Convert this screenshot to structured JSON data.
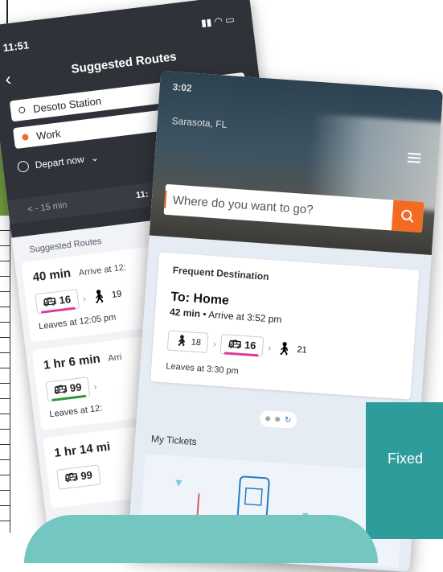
{
  "routes_screen": {
    "status_time": "11:51",
    "title": "Suggested Routes",
    "origin": "Desoto Station",
    "destination": "Work",
    "depart_label": "Depart now",
    "time_prev": "< - 15 min",
    "time_current": "11:",
    "section_label": "Suggested Routes",
    "routes": [
      {
        "duration": "40 min",
        "arrive": "Arrive at 12:",
        "bus": "16",
        "bus_color": "#e0399a",
        "walk": "19",
        "leaves": "Leaves at 12:05 pm"
      },
      {
        "duration": "1 hr 6 min",
        "arrive": "Arri",
        "bus": "99",
        "bus_color": "#2d9a3a",
        "walk": "",
        "leaves": "Leaves at 12:"
      },
      {
        "duration": "1 hr 14 mi",
        "arrive": "",
        "bus": "99",
        "bus_color": "#2d9a3a",
        "walk": "",
        "leaves": ""
      }
    ]
  },
  "home_screen": {
    "status_time": "3:02",
    "city": "Sarasota, FL",
    "search_placeholder": "Where do you want to go?",
    "frequent_label": "Frequent Destination",
    "to": "To: Home",
    "duration": "42 min",
    "arrive": "Arrive at 3:52 pm",
    "walk1": "18",
    "bus": "16",
    "bus_color": "#e0399a",
    "walk2": "21",
    "leaves": "Leaves at 3:30 pm",
    "tickets_label": "My Tickets"
  },
  "overlay": {
    "fixed_label": "Fixed",
    "accent_teal": "#2e9c9a",
    "accent_orange": "#f26b21"
  }
}
